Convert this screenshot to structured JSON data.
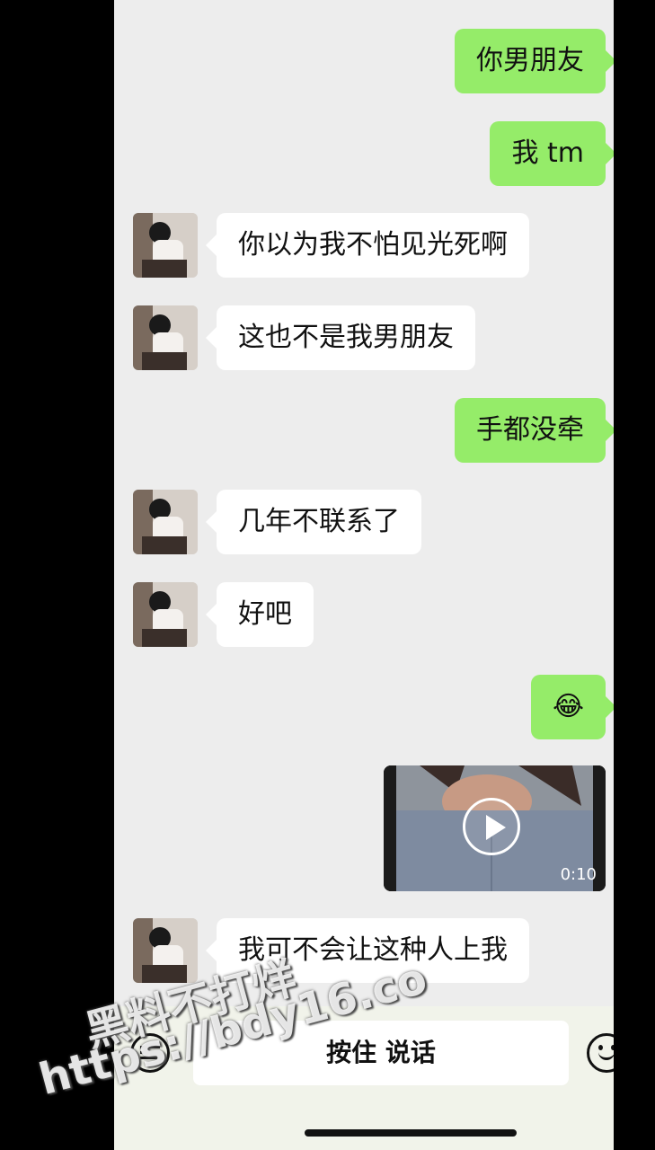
{
  "messages": [
    {
      "side": "out",
      "text": "你男朋友"
    },
    {
      "side": "out",
      "text": "我 tm"
    },
    {
      "side": "in",
      "text": "你以为我不怕见光死啊"
    },
    {
      "side": "in",
      "text": "这也不是我男朋友"
    },
    {
      "side": "out",
      "text": "手都没牵"
    },
    {
      "side": "in",
      "text": "几年不联系了"
    },
    {
      "side": "in",
      "text": "好吧"
    },
    {
      "side": "out",
      "text": "😂"
    },
    {
      "side": "out",
      "type": "video",
      "duration": "0:10"
    },
    {
      "side": "in",
      "text": "我可不会让这种人上我"
    }
  ],
  "input_bar": {
    "voice_label": "按住 说话",
    "left_icon": "keyboard-icon",
    "right_icon": "emoji-icon"
  },
  "watermark": {
    "line1": "黑料不打烊",
    "line2": "https://bdy16.co"
  },
  "colors": {
    "outgoing": "#95ec69",
    "incoming": "#ffffff",
    "background": "#ededed"
  }
}
